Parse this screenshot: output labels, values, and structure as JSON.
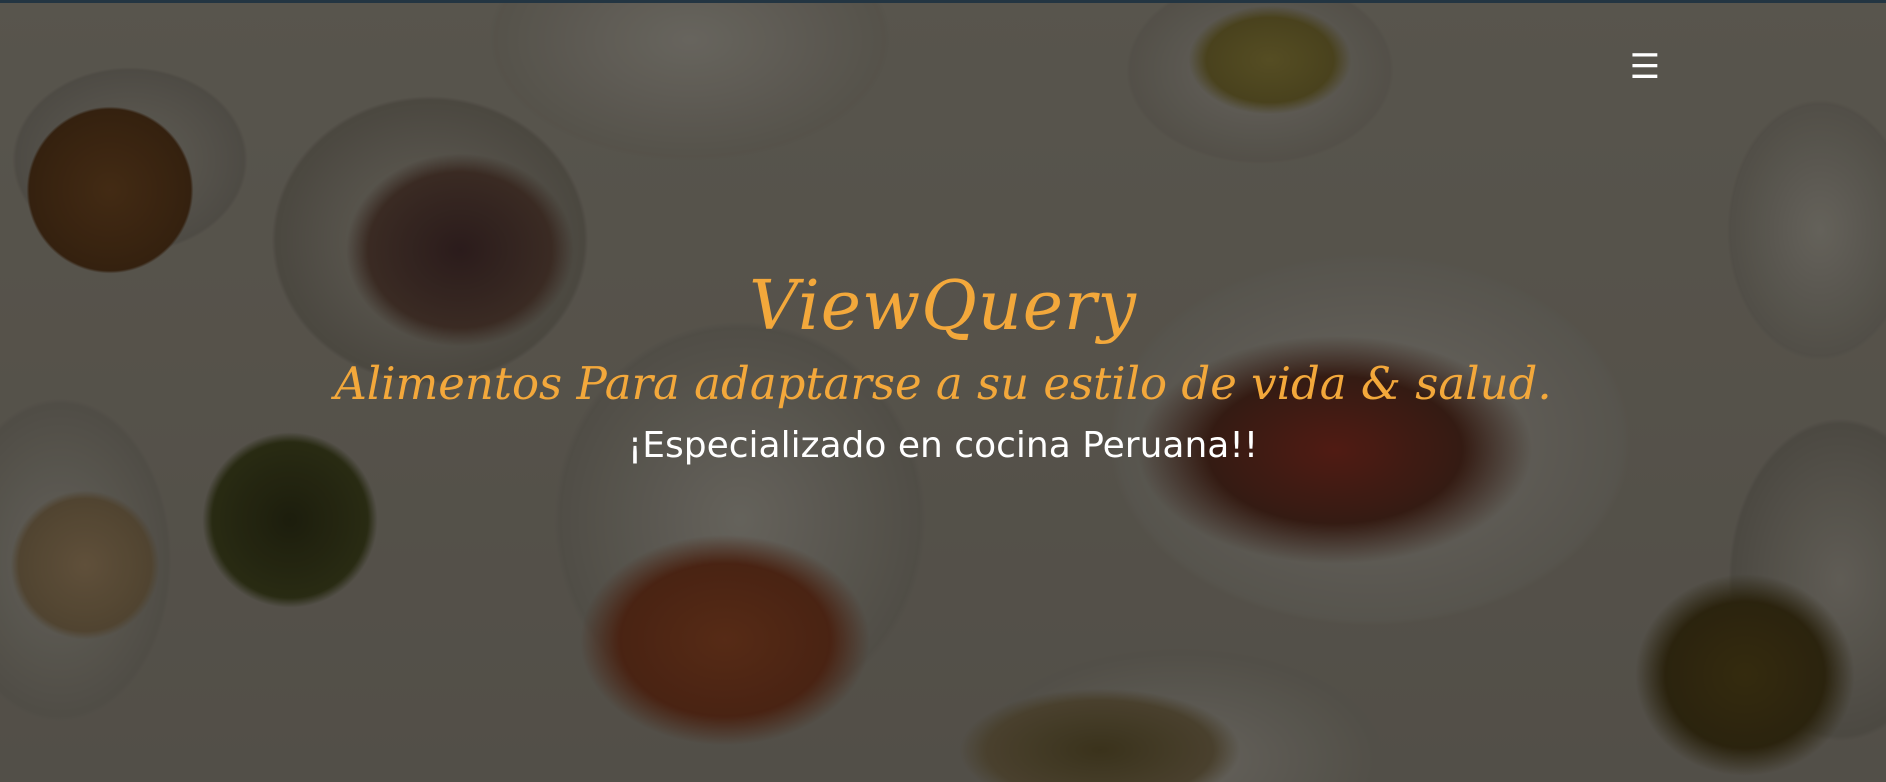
{
  "header": {
    "menu_icon": "hamburger-menu-icon",
    "menu_glyph": "☰"
  },
  "hero": {
    "brand": "ViewQuery",
    "tagline": "Alimentos Para adaptarse a su estilo de vida & salud.",
    "subtitle": "¡Especializado en cocina Peruana!!",
    "background_image": "overhead view of a table with plates of food"
  },
  "colors": {
    "accent": "#f3a83b",
    "text": "#ffffff",
    "overlay": "rgba(0,0,0,0.52)"
  }
}
